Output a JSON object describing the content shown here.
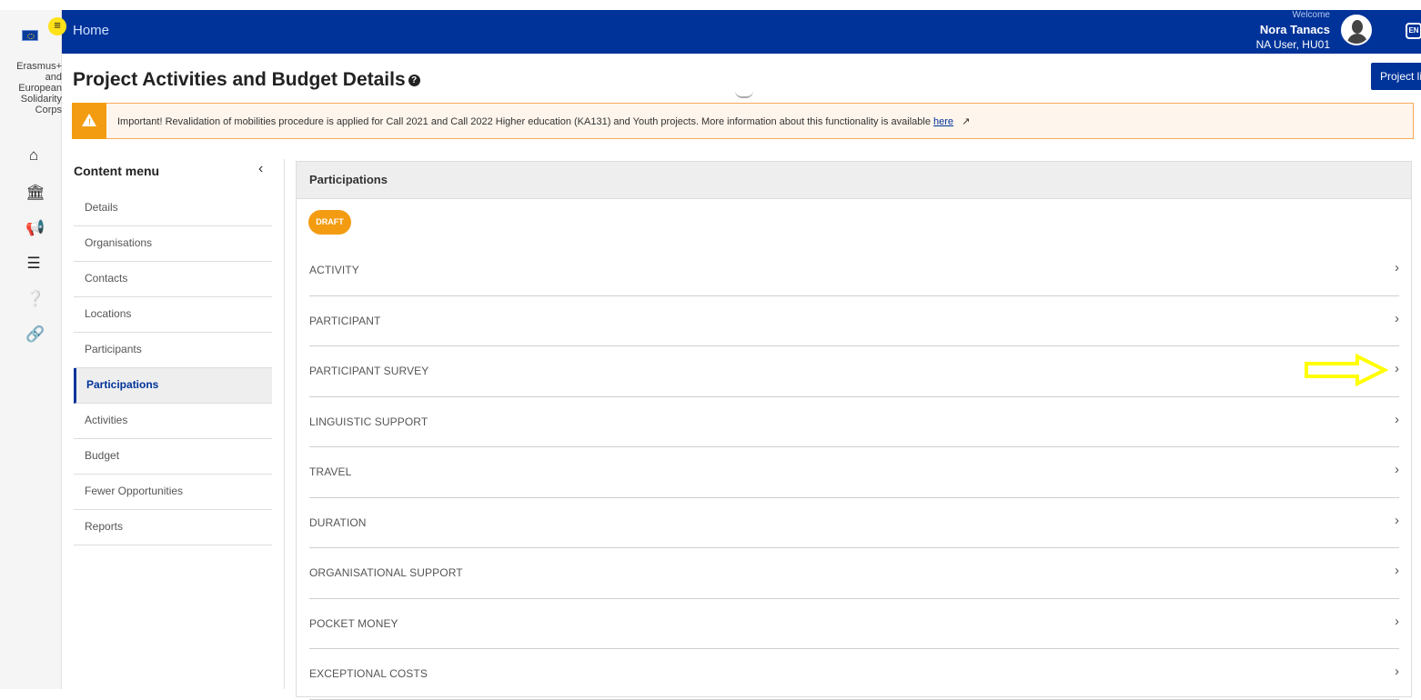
{
  "app": {
    "brand": "Erasmus+ and European Solidarity Corps",
    "menu_toggle": "≡"
  },
  "topbar": {
    "home": "Home",
    "welcome": "Welcome",
    "user_name": "Nora Tanacs",
    "user_role": "NA User, HU01",
    "lang": "EN"
  },
  "page": {
    "title": "Project Activities and Budget Details",
    "project_button": "Project list"
  },
  "alert": {
    "text": "Important! Revalidation of mobilities procedure is applied for Call 2021 and Call 2022 Higher education (KA131) and Youth projects. More information about this functionality is available",
    "link": "here"
  },
  "content_menu": {
    "heading": "Content menu",
    "items": [
      {
        "label": "Details"
      },
      {
        "label": "Organisations"
      },
      {
        "label": "Contacts"
      },
      {
        "label": "Locations"
      },
      {
        "label": "Participants"
      },
      {
        "label": "Participations",
        "active": true
      },
      {
        "label": "Activities"
      },
      {
        "label": "Budget"
      },
      {
        "label": "Fewer Opportunities"
      },
      {
        "label": "Reports"
      }
    ]
  },
  "panel": {
    "heading": "Participations",
    "status_badge": "DRAFT",
    "sections": [
      {
        "label": "ACTIVITY"
      },
      {
        "label": "PARTICIPANT"
      },
      {
        "label": "PARTICIPANT SURVEY"
      },
      {
        "label": "LINGUISTIC SUPPORT"
      },
      {
        "label": "TRAVEL"
      },
      {
        "label": "DURATION"
      },
      {
        "label": "ORGANISATIONAL SUPPORT"
      },
      {
        "label": "POCKET MONEY"
      },
      {
        "label": "EXCEPTIONAL COSTS"
      }
    ]
  },
  "colors": {
    "primary": "#003399",
    "accent_yellow": "#ffe11a",
    "warning": "#f39c12",
    "annotation_arrow": "#ffff00"
  }
}
